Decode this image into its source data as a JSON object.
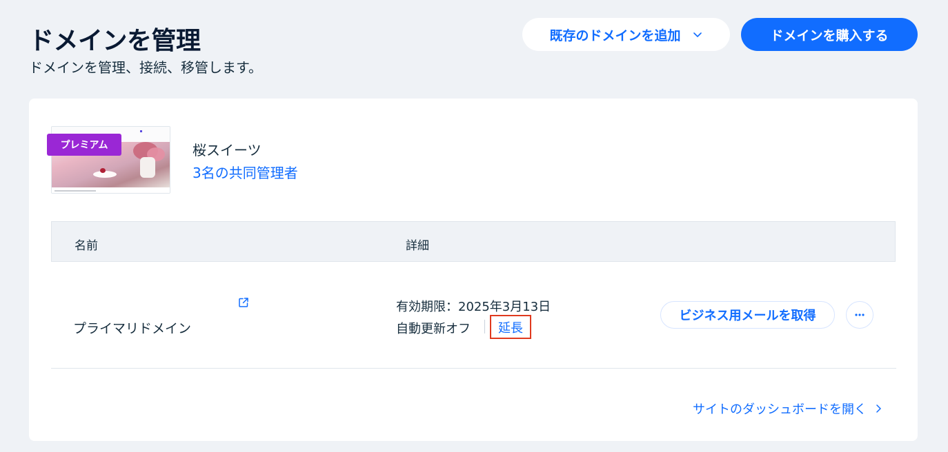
{
  "header": {
    "title": "ドメインを管理",
    "subtitle": "ドメインを管理、接続、移管します。",
    "add_existing_label": "既存のドメインを追加",
    "buy_label": "ドメインを購入する"
  },
  "site": {
    "badge": "プレミアム",
    "name": "桜スイーツ",
    "co_admins": "3名の共同管理者"
  },
  "table": {
    "columns": [
      "名前",
      "詳細"
    ],
    "rows": [
      {
        "name": "プライマリドメイン",
        "expiry": "有効期限：2025年3月13日",
        "auto_renew": "自動更新オフ",
        "extend_label": "延長",
        "email_button": "ビジネス用メールを取得"
      }
    ]
  },
  "footer": {
    "dashboard_link": "サイトのダッシュボードを開く"
  },
  "icons": {
    "add_dropdown": "chevron-down-icon",
    "external": "external-link-icon",
    "more": "more-dots-icon",
    "dashboard": "chevron-right-icon"
  },
  "colors": {
    "accent": "#116dff",
    "premium": "#9a27d5",
    "highlight": "#e0391e",
    "background": "#eff2f6"
  }
}
